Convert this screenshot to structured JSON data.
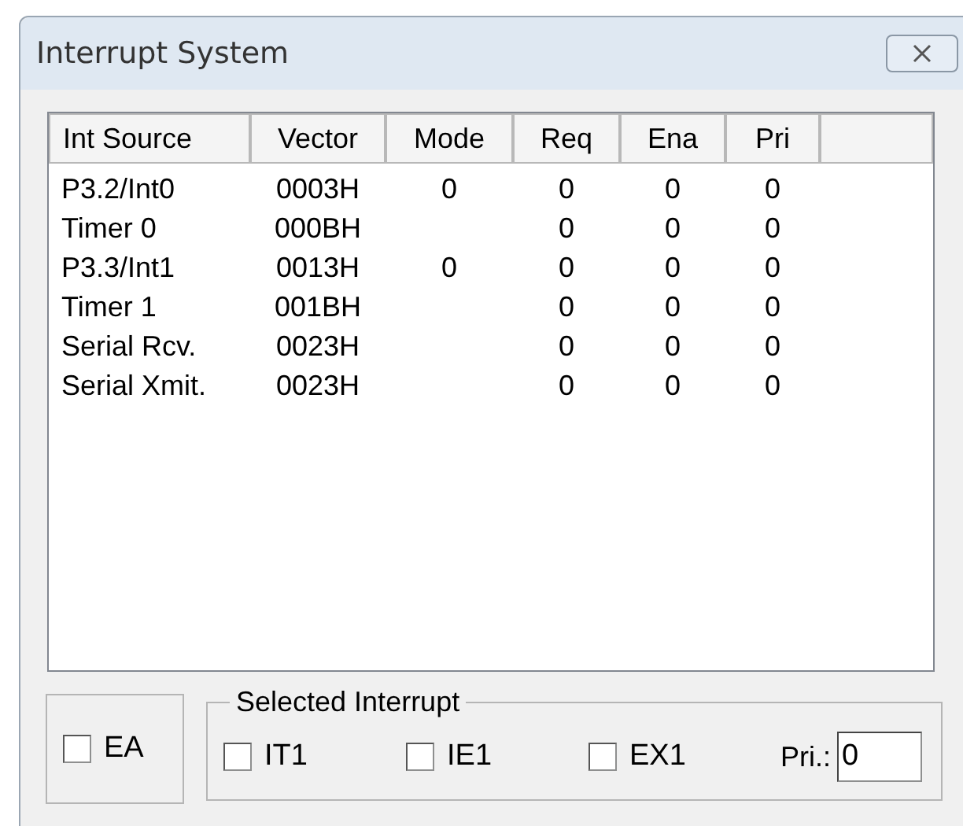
{
  "window": {
    "title": "Interrupt System"
  },
  "table": {
    "columns": [
      "Int Source",
      "Vector",
      "Mode",
      "Req",
      "Ena",
      "Pri"
    ],
    "rows": [
      [
        "P3.2/Int0",
        "0003H",
        "0",
        "0",
        "0",
        "0"
      ],
      [
        "Timer 0",
        "000BH",
        "",
        "0",
        "0",
        "0"
      ],
      [
        "P3.3/Int1",
        "0013H",
        "0",
        "0",
        "0",
        "0"
      ],
      [
        "Timer 1",
        "001BH",
        "",
        "0",
        "0",
        "0"
      ],
      [
        "Serial Rcv.",
        "0023H",
        "",
        "0",
        "0",
        "0"
      ],
      [
        "Serial Xmit.",
        "0023H",
        "",
        "0",
        "0",
        "0"
      ]
    ]
  },
  "ea": {
    "label": "EA",
    "checked": false
  },
  "selected_interrupt": {
    "title": "Selected Interrupt",
    "checkboxes": [
      {
        "label": "IT1",
        "checked": false
      },
      {
        "label": "IE1",
        "checked": false
      },
      {
        "label": "EX1",
        "checked": false
      }
    ],
    "priority": {
      "label": "Pri.:",
      "value": "0"
    }
  }
}
